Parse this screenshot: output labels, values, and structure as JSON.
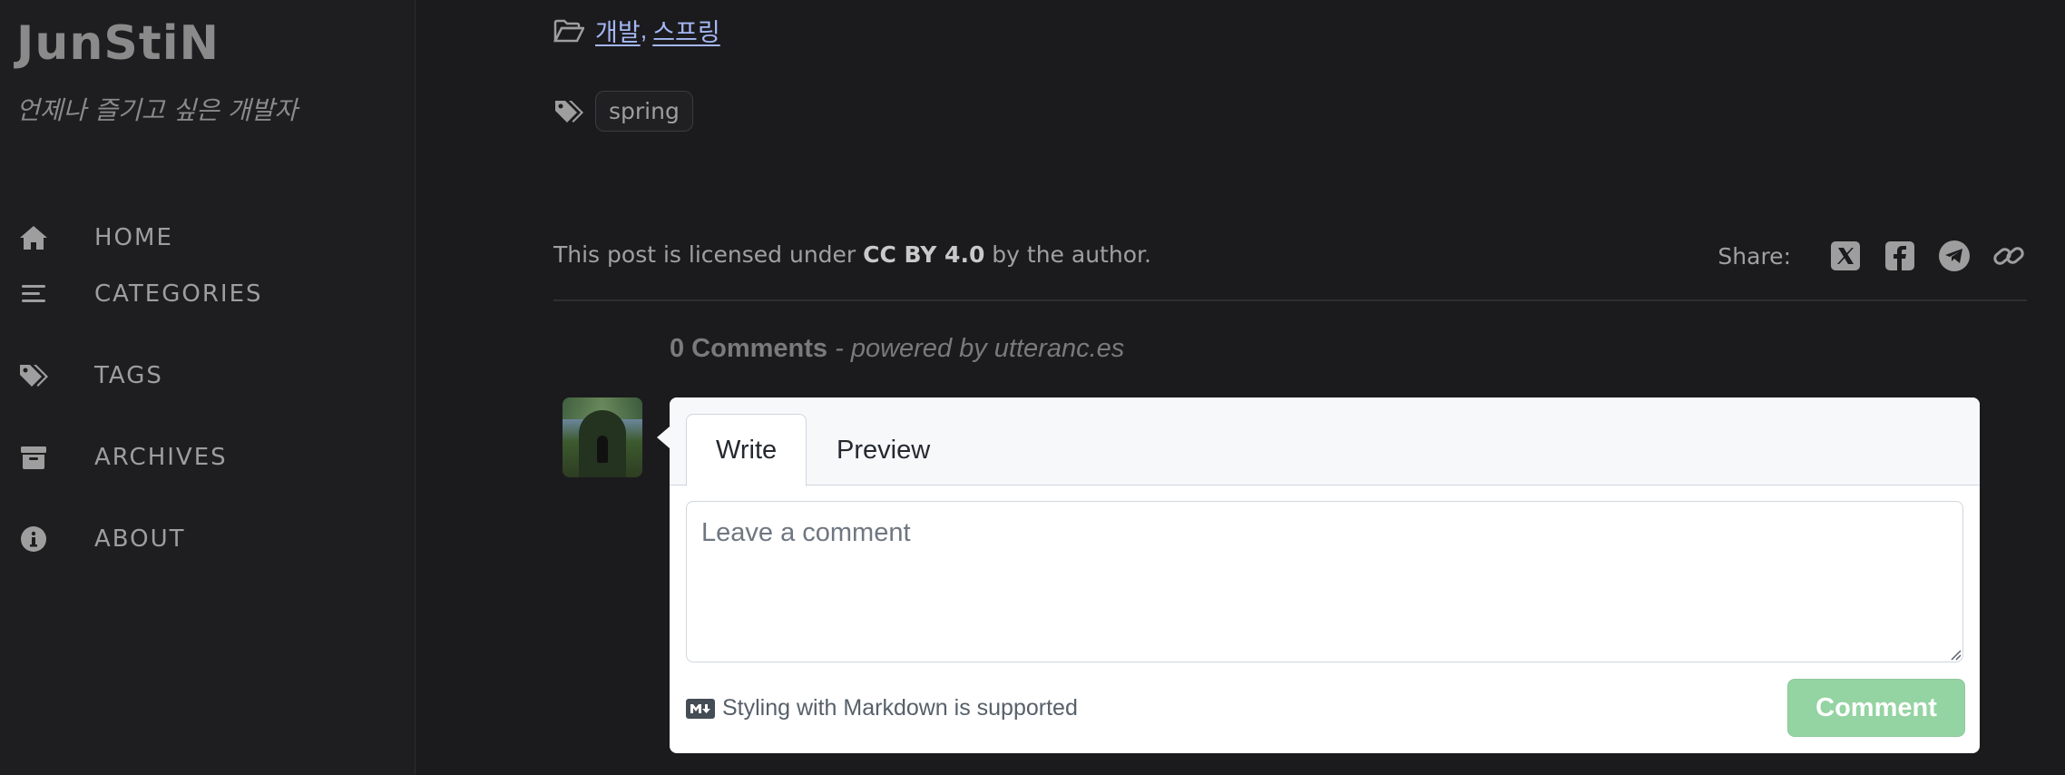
{
  "sidebar": {
    "title": "JunStiN",
    "subtitle": "언제나 즐기고 싶은 개발자",
    "items": [
      {
        "label": "HOME",
        "icon": "home-icon"
      },
      {
        "label": "CATEGORIES",
        "icon": "stream-icon"
      },
      {
        "label": "TAGS",
        "icon": "tags-icon"
      },
      {
        "label": "ARCHIVES",
        "icon": "archive-icon"
      },
      {
        "label": "ABOUT",
        "icon": "info-icon"
      }
    ]
  },
  "post": {
    "categories": [
      "개발",
      "스프링"
    ],
    "category_separator": ",",
    "tags": [
      "spring"
    ],
    "license_prefix": "This post is licensed under",
    "license_name": "CC BY 4.0",
    "license_suffix": "by the author.",
    "share_label": "Share:",
    "share_icons": [
      "x-twitter-icon",
      "facebook-icon",
      "telegram-icon",
      "link-icon"
    ]
  },
  "comments": {
    "count_label": "0 Comments",
    "powered_by": "- powered by utteranc.es",
    "tabs": [
      "Write",
      "Preview"
    ],
    "active_tab": "Write",
    "placeholder": "Leave a comment",
    "markdown_note": "Styling with Markdown is supported",
    "submit_label": "Comment"
  },
  "colors": {
    "background": "#1b1b1e",
    "link": "#a5b7f5",
    "comment_button": "#94d3a2"
  }
}
